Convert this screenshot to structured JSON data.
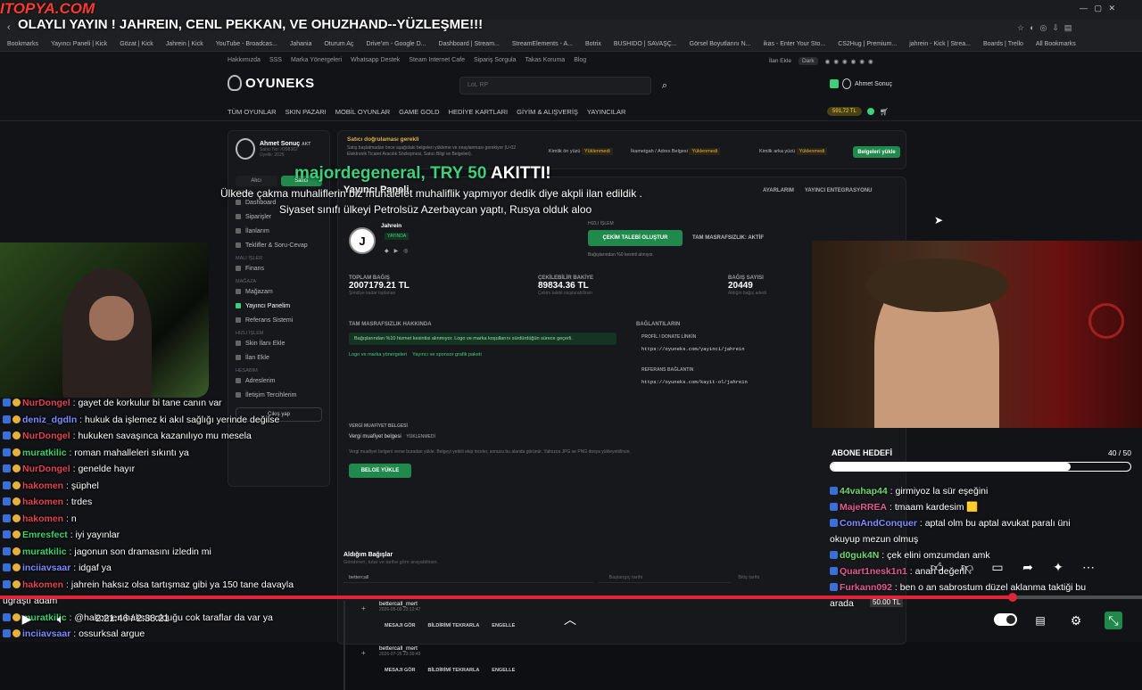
{
  "stream": {
    "watermark": "ITOPYA.COM",
    "title": "OLAYLI YAYIN ! JAHREIN, CENL PEKKAN, VE OHUZHAND--YÜZLEŞME!!!",
    "time": "2:21:46 / 2:38:21",
    "progress": 0.887
  },
  "bookmarks": [
    "Bookmarks",
    "Yayıncı Paneli | Kick",
    "Gözat | Kick",
    "Jahrein | Kick",
    "YouTube - Broadcas...",
    "Jahania",
    "Oturum Aç",
    "Drive'ım - Google D...",
    "Dashboard | Stream...",
    "StreamElements - A...",
    "Botrix",
    "BUSHIDO | SAVAŞÇ...",
    "Görsel Boyutlarını N...",
    "ikas - Enter Your Sto...",
    "CS2Hug | Premium...",
    "jahrein - Kick | Strea...",
    "Boards | Trello",
    "All Bookmarks"
  ],
  "site": {
    "topnav": [
      "Hakkımızda",
      "SSS",
      "Marka Yönergeleri",
      "Whatsapp Destek",
      "Steam Internet Cafe",
      "Sipariş Sorgula",
      "Takas Koruma",
      "Blog"
    ],
    "topnav_right": [
      "İlan Ekle",
      "Dark"
    ],
    "logo": "OYUNEKS",
    "search_placeholder": "LoL RP",
    "user": "Ahmet Sonuç",
    "balance": "591,72 TL",
    "mainnav": [
      "TÜM OYUNLAR",
      "SKIN PAZARI",
      "MOBİL OYUNLAR",
      "GAME GOLD",
      "HEDİYE KARTLARI",
      "GİYİM & ALIŞVERİŞ",
      "YAYINCILAR"
    ],
    "profile": {
      "name": "Ahmet Sonuç",
      "tag": "AKT",
      "meta1": "Satıcı No: #298362",
      "meta2": "Üyelik: 2025"
    },
    "tabs": [
      "Alıcı",
      "Satıcı"
    ],
    "sidebar_sections": [
      "Genel",
      "Mali İşler",
      "Mağaza",
      "Hızlı İşlem",
      "Hesabım"
    ],
    "sidebar": [
      "Dashboard",
      "Siparişler",
      "İlanlarım",
      "Teklifler & Soru-Cevap",
      "Finans",
      "Mağazam",
      "Yayıncı Panelim",
      "Referans Sistemi",
      "Skin İlanı Ekle",
      "İlan Ekle",
      "Adreslerim",
      "İletişim Tercihlerim"
    ],
    "logout": "Çıkış yap",
    "verify": {
      "title": "Satıcı doğrulaması gerekli",
      "text": "Satış başlatmadan önce aşağıdaki belgeleri yükleme ve onaylanması gerekiyor (U-02 Elektronik Ticaret Aracılık Sözleşmesi, Satıcı Bilgi ve Belgeleri).",
      "items": [
        "Kimlik ön yüzü",
        "İkametgah / Adres Belgesi",
        "Kimlik arka yüzü"
      ],
      "status": "Yüklenmedi",
      "button": "Belgeleri yükle"
    },
    "panel_title": "Yayıncı Paneli",
    "tabs_right": [
      "AYARLARIM",
      "YAYINCI ENTEGRASYONU"
    ],
    "streamer": {
      "name": "Jahrein",
      "status": "YAYINDA"
    },
    "quick": {
      "title": "HIZLI İŞLEM",
      "button": "ÇEKİM TALEBİ OLUŞTUR",
      "tag": "TAM MASRAFSIZLIK: AKTİF",
      "note": "Bağışlarından %0 kesinti alınıyor."
    },
    "stats": [
      {
        "label": "TOPLAM BAĞIŞ",
        "value": "2007179.21 TL",
        "sub": "Şimdiye kadar toplanan"
      },
      {
        "label": "ÇEKİLEBİLİR BAKİYE",
        "value": "89834.36 TL",
        "sub": "Çekim talebi oluşturabilirsin"
      },
      {
        "label": "BAĞIŞ SAYISI",
        "value": "20449",
        "sub": "Aldığın bağış adedi"
      }
    ],
    "masraf": {
      "title": "TAM MASRAFSIZLIK HAKKINDA",
      "text": "Bağışlarından %10 hizmet kesintisi alınmıyor. Logo ve marka koşullarını sürdürdüğün sürece geçerli.",
      "links": [
        "Logo ve marka yönergeleri",
        "Yayıncı ve sponsor grafik paketi"
      ]
    },
    "links": {
      "title": "BAĞLANTILARIN",
      "profile_label": "PROFİL / DONATE LİNKİN",
      "profile_url": "https://oyuneks.com/yayinci/jahrein",
      "ref_label": "REFERANS BAĞLANTIN",
      "ref_url": "https://oyuneks.com/kayit-ol/jahrein"
    },
    "tax": {
      "title": "VERGİ MUAFİYET BELGESİ",
      "label": "Vergi muafiyet belgesi",
      "status": "YÜKLENMEDİ",
      "text": "Vergi muafiyet belgeni verse buradan yükle. Belgeyi yetkili ekip inceler, sonucu bu alanda görünür. Yalnızca JPG ve PNG dosya yükleyebilirsin.",
      "button": "BELGE YÜKLE"
    },
    "donations": {
      "title": "Aldığım Bağışlar",
      "sub": "Gönderen, tutar ve tarihe göre arayabilirsin.",
      "search": "bettercall",
      "date_placeholder": "Başlangıç tarihi",
      "date2": "Bitiş tarihi",
      "rows": [
        {
          "name": "bettercall_mert",
          "date": "2026-05-09 23:12:47"
        },
        {
          "name": "bettercall_mert",
          "date": "2026-07-26 23:39:49"
        }
      ],
      "actions": [
        "MESAJI GÖR",
        "BİLDİRİMİ TEKRARLA",
        "ENGELLE"
      ]
    }
  },
  "alert": {
    "name": "majordegeneral,",
    "amount": "TRY 50",
    "suffix": "AKITTI!",
    "msg1": "Ülkede çakma muhaliflerin biz muhalefet muhaliflik yapmıyor dedik diye akpli ilan edildik .",
    "msg2": "Siyaset sınıfı ülkeyi Petrolsüz Azerbaycan yaptı, Rusya olduk aloo"
  },
  "left_chat": [
    {
      "user": "NurDongel",
      "color": "#e0454f",
      "msg": "gayet de korkulur bi tane canın var"
    },
    {
      "user": "deniz_dgdln",
      "color": "#7c8cff",
      "msg": "hukuk da işlemez ki akıl sağlığı yerinde değilse"
    },
    {
      "user": "NurDongel",
      "color": "#e0454f",
      "msg": "hukuken savaşınca kazanılıyo mu mesela"
    },
    {
      "user": "muratkilic",
      "color": "#36d36a",
      "msg": "roman mahalleleri sıkıntı ya"
    },
    {
      "user": "NurDongel",
      "color": "#e0454f",
      "msg": "genelde hayır"
    },
    {
      "user": "hakomen",
      "color": "#e0454f",
      "msg": "şüphel"
    },
    {
      "user": "hakomen",
      "color": "#e0454f",
      "msg": "trdes"
    },
    {
      "user": "hakomen",
      "color": "#e0454f",
      "msg": "n"
    },
    {
      "user": "Emresfect",
      "color": "#36d36a",
      "msg": "iyi yayınlar"
    },
    {
      "user": "muratkilic",
      "color": "#36d36a",
      "msg": "jagonun son dramasını izledin mi"
    },
    {
      "user": "inciiavsaar",
      "color": "#7c8cff",
      "msg": "idgaf ya"
    },
    {
      "user": "hakomen",
      "color": "#e0454f",
      "msg": "jahrein haksız olsa tartışmaz gibi ya 150 tane davayla"
    },
    {
      "user": "",
      "color": "#fff",
      "msg": "uğraştı adam"
    },
    {
      "user": "muratkilic",
      "color": "#36d36a",
      "msg": "@hakomen haksız olduğu cok taraflar da var ya"
    },
    {
      "user": "inciiavsaar",
      "color": "#7c8cff",
      "msg": "ossurksal argue"
    }
  ],
  "goal": {
    "label": "ABONE HEDEFİ",
    "value": "40 / 50",
    "fill": 0.8
  },
  "right_chat": [
    {
      "user": "44vahap44",
      "color": "#6fd66f",
      "msg": "girmiyoz la sür eşeğini"
    },
    {
      "user": "MajeRREA",
      "color": "#e05a8c",
      "msg": "tmaam kardesim 🟨"
    },
    {
      "user": "ComAndConquer",
      "color": "#7c8cff",
      "msg": "aptal olm bu aptal avukat paralı üni"
    },
    {
      "user": "",
      "color": "#fff",
      "msg": "okuyup mezun olmuş"
    },
    {
      "user": "d0guk4N",
      "color": "#6fd66f",
      "msg": "çek elini omzumdan amk"
    },
    {
      "user": "Quart1nesk1n1",
      "color": "#e05a8c",
      "msg": "anan değerli"
    },
    {
      "user": "Furkann092",
      "color": "#e05a8c",
      "msg": "ben o an sabrostum düzel aklanma taktiği bu"
    },
    {
      "user": "",
      "color": "#fff",
      "msg": "arada"
    }
  ],
  "donation_badge": "50.00 TL"
}
